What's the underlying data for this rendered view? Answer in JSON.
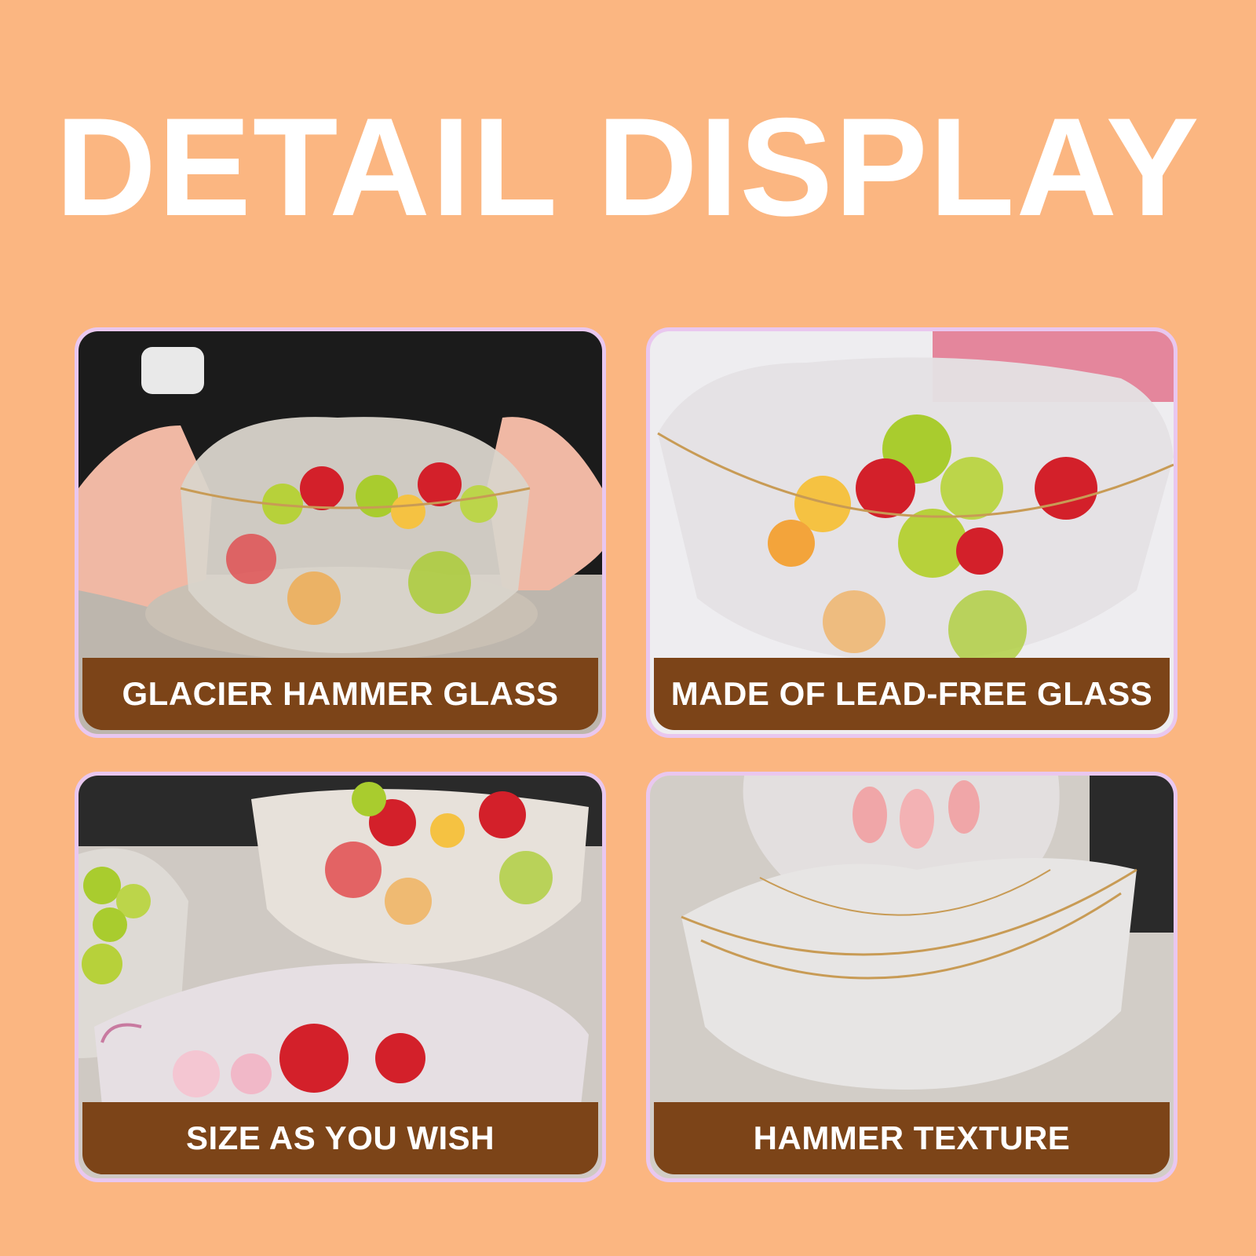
{
  "background_color": "#fbb681",
  "accent_color": "#7c4418",
  "headline": "DETAIL DISPLAY",
  "cards": [
    {
      "label": "GLACIER HAMMER GLASS"
    },
    {
      "label": "MADE OF LEAD-FREE GLASS"
    },
    {
      "label": "SIZE AS YOU WISH"
    },
    {
      "label": "HAMMER TEXTURE"
    }
  ]
}
